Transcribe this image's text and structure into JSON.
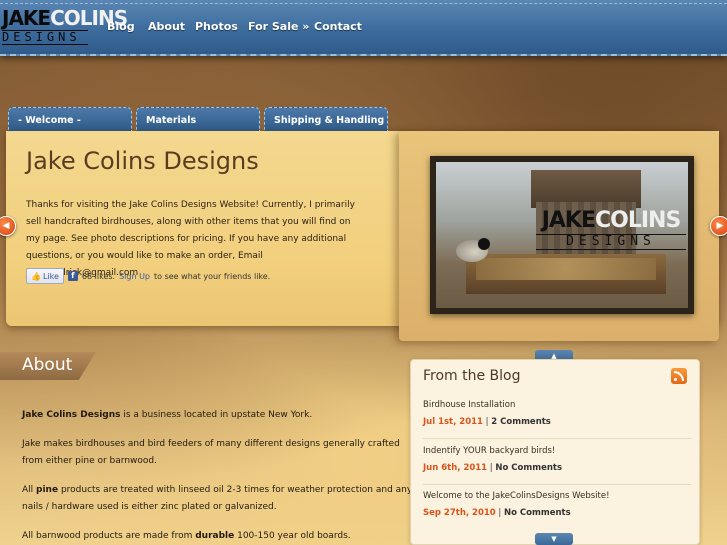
{
  "brand": {
    "logo_top_a": "JAKE",
    "logo_top_b": "COLINS",
    "logo_bottom": "DESIGNS"
  },
  "nav": {
    "items": [
      {
        "label": "Blog"
      },
      {
        "label": "About"
      },
      {
        "label": "Photos"
      },
      {
        "label": "For Sale »"
      },
      {
        "label": "Contact"
      }
    ]
  },
  "tabs": [
    {
      "label": "- Welcome -"
    },
    {
      "label": "Materials"
    },
    {
      "label": "Shipping & Handling"
    }
  ],
  "slide": {
    "title": "Jake Colins Designs",
    "text": "Thanks for visiting the Jake Colins Designs Website! Currently, I primarily sell handcrafted birdhouses, along with other items that you will find on my page. See photo descriptions for pricing. If you have any additional questions, or you would like to make an order, Email jacobwidrick@gmail.com",
    "photo_watermark_a": "JAKE",
    "photo_watermark_b": "COLINS",
    "photo_watermark_sub": "DESIGNS"
  },
  "facebook": {
    "like_label": "Like",
    "count_text": "68 likes.",
    "signup_label": "Sign Up",
    "suffix": "to see what your friends like."
  },
  "about": {
    "title": "About",
    "p1_bold": "Jake Colins Designs",
    "p1_rest": " is a business located in upstate  New York.",
    "p2": "Jake makes birdhouses and bird feeders of many different designs generally crafted from either pine or barnwood.",
    "p3_a": "All ",
    "p3_bold": "pine",
    "p3_b": " products are treated with linseed oil 2-3 times for weather protection and any nails / hardware used is either zinc plated or galvanized.",
    "p4_a": "All barnwood products are made from ",
    "p4_bold": "durable",
    "p4_b": " 100-150 year old boards."
  },
  "blog": {
    "title": "From the Blog",
    "posts": [
      {
        "title": "Birdhouse Installation",
        "date": "Jul 1st, 2011",
        "comments": "2 Comments"
      },
      {
        "title": "Indentify YOUR backyard birds!",
        "date": "Jun 6th, 2011",
        "comments": "No Comments"
      },
      {
        "title": "Welcome to the JakeColinsDesigns Website!",
        "date": "Sep 27th, 2010",
        "comments": "No Comments"
      }
    ],
    "separator": " | "
  },
  "colors": {
    "nav_blue": "#3d6c9d",
    "accent_orange": "#d9541a",
    "panel_yellow": "#f1cf7d"
  },
  "icons": {
    "prev": "arrow-left-icon",
    "next": "arrow-right-icon",
    "rss": "rss-icon",
    "facebook": "facebook-icon",
    "scroll_up": "chevron-up-icon",
    "scroll_down": "chevron-down-icon"
  }
}
